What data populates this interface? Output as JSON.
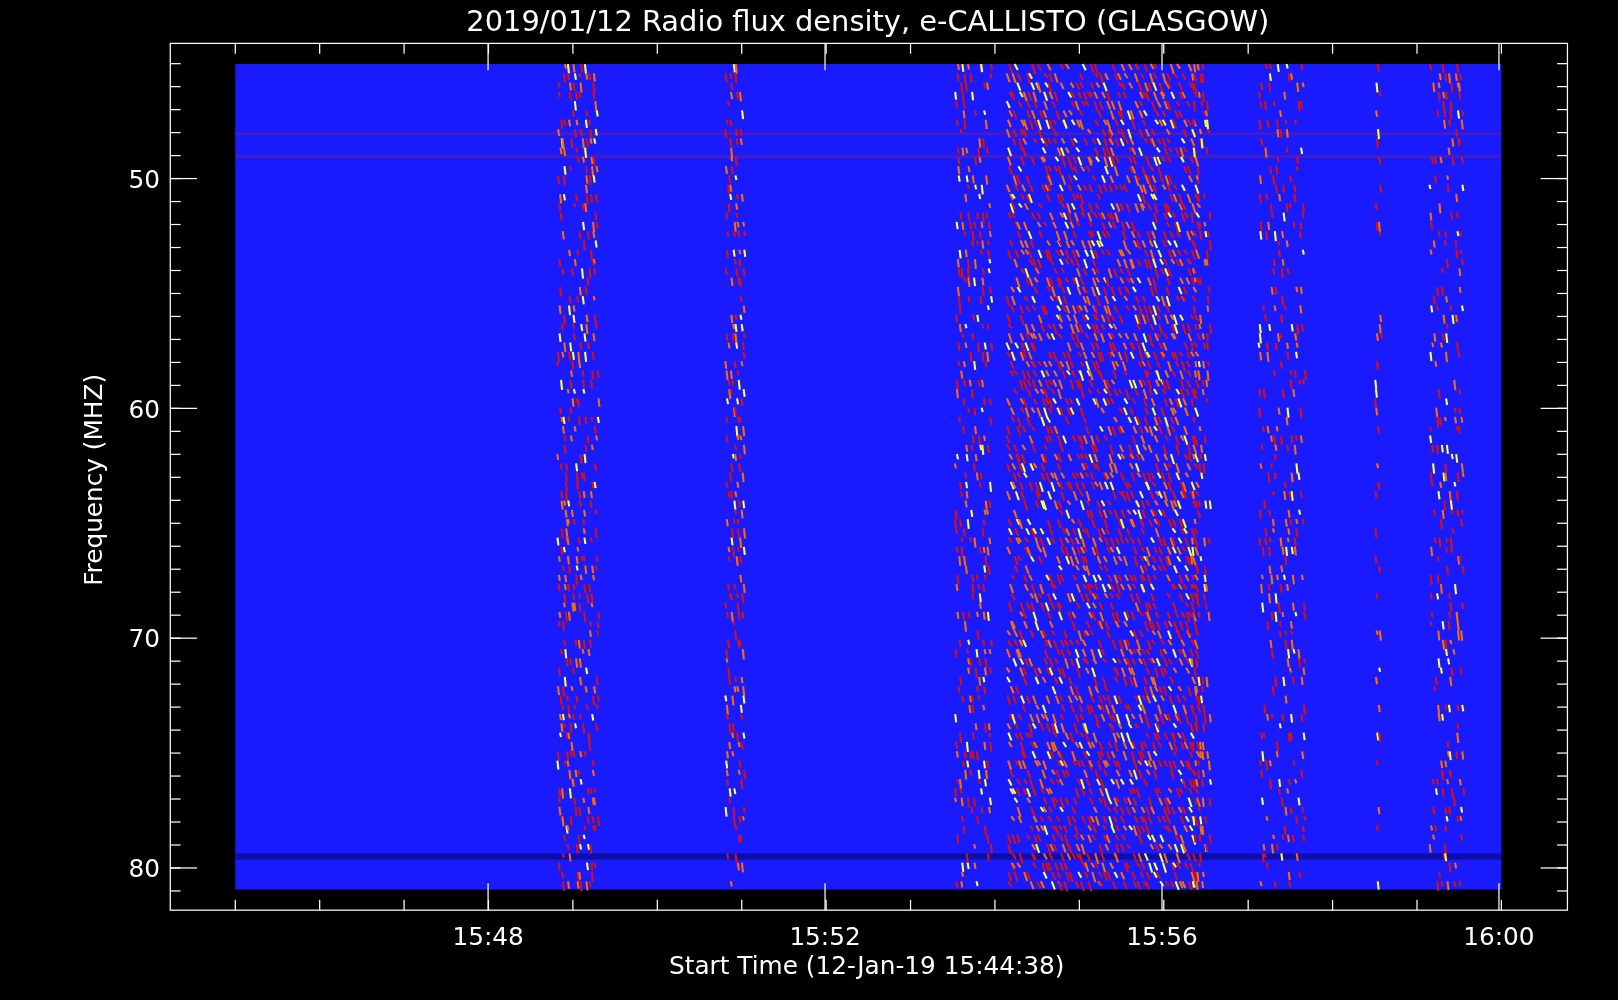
{
  "title": "2019/01/12  Radio flux density, e-CALLISTO (GLASGOW)",
  "y_axis": {
    "label": "Frequency (MHZ)",
    "tick_labels": [
      "50",
      "60",
      "70",
      "80"
    ]
  },
  "x_axis": {
    "label": "Start Time (12-Jan-19 15:44:38)",
    "tick_labels": [
      "15:48",
      "15:52",
      "15:56",
      "16:00"
    ]
  }
}
